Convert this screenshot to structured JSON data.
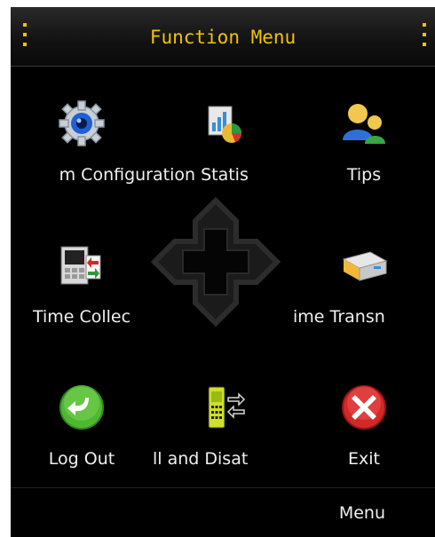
{
  "title": "Function Menu",
  "items": [
    {
      "label": "m Configur",
      "icon": "gear-icon"
    },
    {
      "label": "ation Statis",
      "icon": "statistics-icon"
    },
    {
      "label": "Tips",
      "icon": "users-icon"
    },
    {
      "label": "Time Collec",
      "icon": "sync-phone-icon"
    },
    {
      "label": "ime Transn",
      "icon": "transfer-icon"
    },
    {
      "label": "Log Out",
      "icon": "green-arrow-icon"
    },
    {
      "label": "ll and Disat",
      "icon": "phone-transfer-icon"
    },
    {
      "label": "Exit",
      "icon": "red-x-icon"
    }
  ],
  "softkeys": {
    "right": "Menu"
  }
}
